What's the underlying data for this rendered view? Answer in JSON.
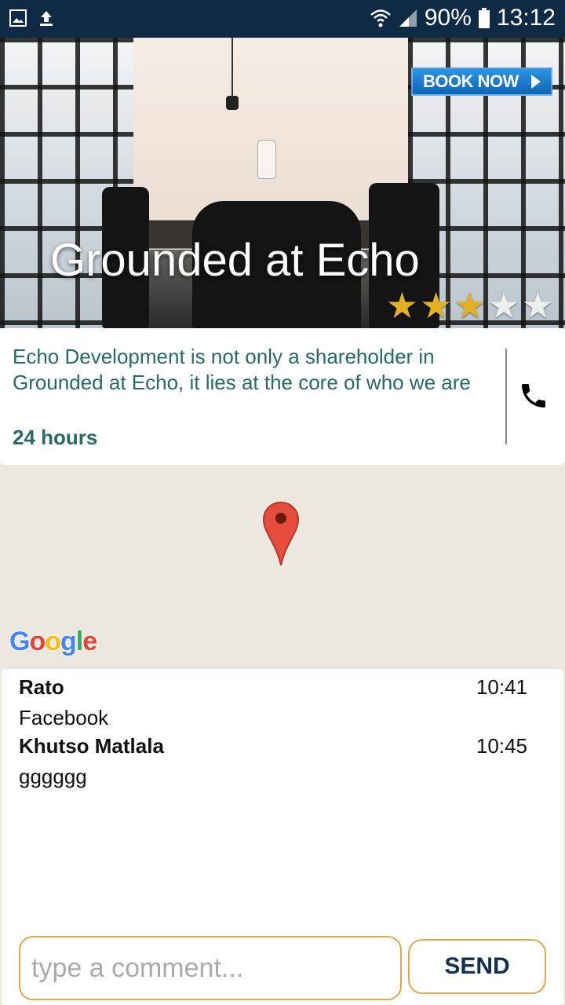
{
  "status_bar": {
    "battery": "90%",
    "time": "13:12"
  },
  "hero": {
    "book_label": "BOOK NOW",
    "title": "Grounded at Echo",
    "rating": 3,
    "max_rating": 5
  },
  "info": {
    "description": "Echo Development is not only a shareholder in Grounded at Echo, it lies at the core of who we are",
    "hours": "24 hours"
  },
  "map": {
    "attribution": "Google"
  },
  "chat": {
    "messages": [
      {
        "name": "Rato",
        "time": "10:41",
        "text": "Facebook"
      },
      {
        "name": "Khutso Matlala",
        "time": "10:45",
        "text": "gggggg"
      }
    ],
    "input_placeholder": "type a comment...",
    "send_label": "SEND"
  },
  "colors": {
    "status_bar": "#0f2a44",
    "accent": "#276b67",
    "border": "#e0a94a",
    "send_text": "#13304e"
  }
}
